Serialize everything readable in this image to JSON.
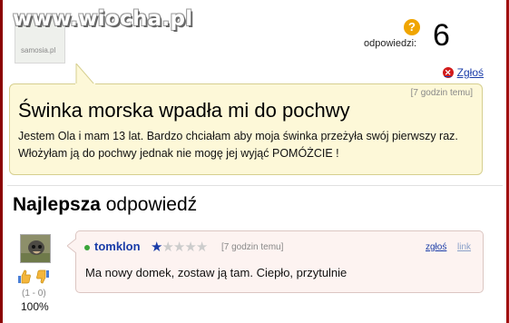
{
  "site": {
    "logo": "www.wiocha.pl",
    "avatar_caption": "samosia.pl"
  },
  "question": {
    "answers_label": "odpowiedzi:",
    "answers_icon": "?",
    "answers_count": "6",
    "report_label": "Zgłoś",
    "time": "[7 godzin temu]",
    "title": "Świnka morska wpadła mi do pochwy",
    "body": "Jestem Ola i mam 13 lat. Bardzo chciałam aby moja świnka przeżyła swój pierwszy raz. Włożyłam ją do pochwy jednak nie mogę jej wyjąć POMÓŻCIE !"
  },
  "best_answer": {
    "heading_bold": "Najlepsza",
    "heading_rest": " odpowiedź",
    "user": "tomklon",
    "rating": 1,
    "rating_max": 5,
    "time": "[7 godzin temu]",
    "report_label": "zgłoś",
    "link_label": "link",
    "body": "Ma nowy domek, zostaw ją tam. Ciepło, przytulnie",
    "vote_counts": "(1 - 0)",
    "vote_percent": "100%"
  },
  "colors": {
    "link": "#1a3ca8",
    "question_bg": "#fdf8d8",
    "answer_bg": "#fdf3f1",
    "frame": "#8b0000"
  }
}
